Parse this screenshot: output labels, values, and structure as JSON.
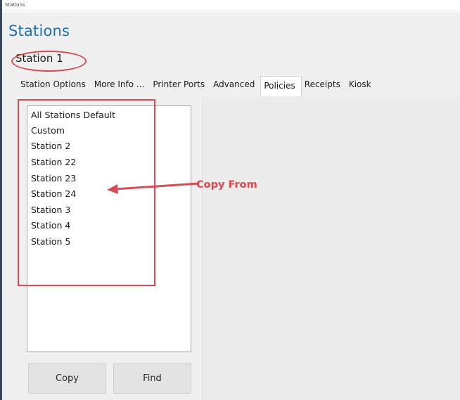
{
  "window": {
    "title": "Stations"
  },
  "header": {
    "title": "Stations",
    "subtitle": "Station 1"
  },
  "tabs": [
    {
      "label": "Station Options",
      "selected": false
    },
    {
      "label": "More Info ...",
      "selected": false
    },
    {
      "label": "Printer Ports",
      "selected": false
    },
    {
      "label": "Advanced",
      "selected": false
    },
    {
      "label": "Policies",
      "selected": true
    },
    {
      "label": "Receipts",
      "selected": false
    },
    {
      "label": "Kiosk",
      "selected": false
    }
  ],
  "stations_list": {
    "items": [
      "All Stations Default",
      "Custom",
      "Station 2",
      "Station 22",
      "Station 23",
      "Station 24",
      "Station 3",
      "Station 4",
      "Station 5"
    ]
  },
  "buttons": {
    "copy_label": "Copy",
    "find_label": "Find"
  },
  "annotation": {
    "text": "Copy From",
    "color": "#e0474f"
  },
  "colors": {
    "accent": "#1f6fb2",
    "markup_red": "#d94c55",
    "background": "#f0f0f0"
  }
}
